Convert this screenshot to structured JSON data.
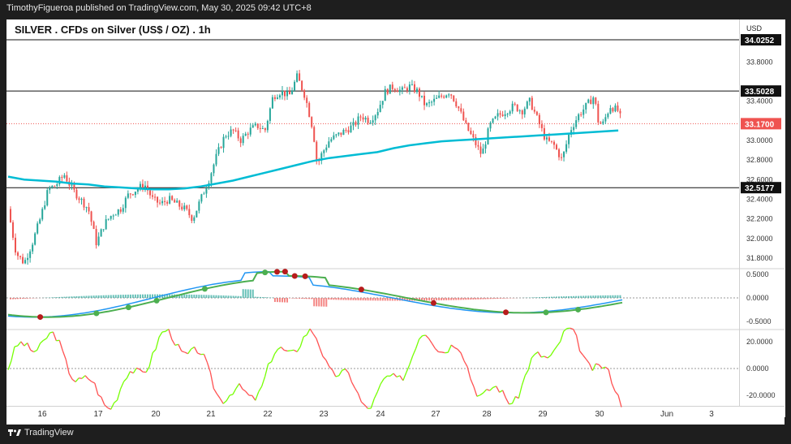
{
  "header": {
    "publish_text": "TimothyFigueroa published on TradingView.com, May 30, 2025 09:42 UTC+8",
    "title": "SILVER . CFDs on Silver (US$ / OZ) . 1h",
    "currency": "USD"
  },
  "footer": {
    "brand": "TradingView"
  },
  "colors": {
    "bull": "#26a69a",
    "bear": "#ef5350",
    "ma": "#00bcd4",
    "fast": "#2196f3",
    "slow_up": "#4caf50",
    "slow_down": "#b71c1c",
    "osc_up": "#76ff03",
    "osc_down": "#ff5252"
  },
  "chart_data": [
    {
      "type": "candlestick",
      "ylim": [
        31.7,
        34.1
      ],
      "y_ticks": [
        "33.8000",
        "33.4000",
        "33.0000",
        "32.8000",
        "32.6000",
        "32.4000",
        "32.2000",
        "32.0000",
        "31.8000"
      ],
      "y_tick_values": [
        33.8,
        33.4,
        33.0,
        32.8,
        32.6,
        32.4,
        32.2,
        32.0,
        31.8
      ],
      "horizontal_levels": [
        {
          "value": 34.0252,
          "label": "34.0252"
        },
        {
          "value": 33.5028,
          "label": "33.5028"
        },
        {
          "value": 32.5177,
          "label": "32.5177"
        }
      ],
      "last_price": {
        "value": 33.17,
        "label": "33.1700"
      },
      "x_ticks": [
        "16",
        "17",
        "20",
        "21",
        "22",
        "23",
        "24",
        "27",
        "28",
        "29",
        "30",
        "Jun",
        "3"
      ],
      "ma_path": [
        [
          0,
          32.63
        ],
        [
          20,
          32.6
        ],
        [
          40,
          32.59
        ],
        [
          60,
          32.58
        ],
        [
          80,
          32.56
        ],
        [
          100,
          32.55
        ],
        [
          120,
          32.53
        ],
        [
          140,
          32.52
        ],
        [
          160,
          32.51
        ],
        [
          180,
          32.5
        ],
        [
          200,
          32.5
        ],
        [
          220,
          32.51
        ],
        [
          240,
          32.53
        ],
        [
          260,
          32.56
        ],
        [
          280,
          32.59
        ],
        [
          300,
          32.63
        ],
        [
          320,
          32.67
        ],
        [
          340,
          32.71
        ],
        [
          360,
          32.75
        ],
        [
          380,
          32.79
        ],
        [
          400,
          32.82
        ],
        [
          420,
          32.84
        ],
        [
          440,
          32.86
        ],
        [
          460,
          32.88
        ],
        [
          480,
          32.92
        ],
        [
          500,
          32.95
        ],
        [
          520,
          32.97
        ],
        [
          540,
          32.99
        ],
        [
          560,
          33.0
        ],
        [
          580,
          33.01
        ],
        [
          600,
          33.02
        ],
        [
          620,
          33.03
        ],
        [
          640,
          33.04
        ],
        [
          660,
          33.05
        ],
        [
          680,
          33.06
        ],
        [
          700,
          33.07
        ],
        [
          720,
          33.08
        ],
        [
          740,
          33.09
        ],
        [
          760,
          33.1
        ]
      ],
      "close_path": [
        [
          0,
          32.3
        ],
        [
          10,
          31.85
        ],
        [
          20,
          31.75
        ],
        [
          30,
          31.95
        ],
        [
          40,
          32.2
        ],
        [
          50,
          32.5
        ],
        [
          60,
          32.55
        ],
        [
          70,
          32.65
        ],
        [
          80,
          32.5
        ],
        [
          90,
          32.4
        ],
        [
          100,
          32.3
        ],
        [
          110,
          31.95
        ],
        [
          120,
          32.15
        ],
        [
          130,
          32.25
        ],
        [
          140,
          32.3
        ],
        [
          150,
          32.45
        ],
        [
          160,
          32.5
        ],
        [
          170,
          32.55
        ],
        [
          180,
          32.4
        ],
        [
          190,
          32.35
        ],
        [
          200,
          32.4
        ],
        [
          210,
          32.35
        ],
        [
          220,
          32.3
        ],
        [
          230,
          32.2
        ],
        [
          240,
          32.4
        ],
        [
          250,
          32.6
        ],
        [
          260,
          32.85
        ],
        [
          270,
          33.05
        ],
        [
          280,
          33.1
        ],
        [
          290,
          33.0
        ],
        [
          300,
          33.1
        ],
        [
          310,
          33.15
        ],
        [
          320,
          33.1
        ],
        [
          330,
          33.45
        ],
        [
          340,
          33.5
        ],
        [
          350,
          33.45
        ],
        [
          360,
          33.65
        ],
        [
          370,
          33.45
        ],
        [
          380,
          33.1
        ],
        [
          385,
          32.75
        ],
        [
          390,
          32.85
        ],
        [
          400,
          33.0
        ],
        [
          410,
          33.05
        ],
        [
          420,
          33.1
        ],
        [
          430,
          33.15
        ],
        [
          440,
          33.25
        ],
        [
          450,
          33.2
        ],
        [
          460,
          33.3
        ],
        [
          470,
          33.5
        ],
        [
          480,
          33.55
        ],
        [
          490,
          33.5
        ],
        [
          500,
          33.55
        ],
        [
          510,
          33.5
        ],
        [
          520,
          33.35
        ],
        [
          530,
          33.4
        ],
        [
          540,
          33.45
        ],
        [
          550,
          33.5
        ],
        [
          560,
          33.35
        ],
        [
          570,
          33.15
        ],
        [
          580,
          33.0
        ],
        [
          590,
          32.85
        ],
        [
          600,
          33.15
        ],
        [
          610,
          33.25
        ],
        [
          620,
          33.3
        ],
        [
          630,
          33.35
        ],
        [
          640,
          33.3
        ],
        [
          650,
          33.4
        ],
        [
          660,
          33.2
        ],
        [
          670,
          33.0
        ],
        [
          680,
          32.95
        ],
        [
          690,
          32.8
        ],
        [
          700,
          33.1
        ],
        [
          710,
          33.25
        ],
        [
          720,
          33.35
        ],
        [
          730,
          33.45
        ],
        [
          735,
          33.2
        ],
        [
          740,
          33.15
        ],
        [
          750,
          33.35
        ],
        [
          760,
          33.3
        ],
        [
          765,
          33.17
        ]
      ]
    },
    {
      "type": "macd",
      "ylim": [
        -0.65,
        0.6
      ],
      "y_ticks": [
        "0.5000",
        "0.0000",
        "-0.5000"
      ],
      "y_tick_values": [
        0.5,
        0.0,
        -0.5
      ]
    },
    {
      "type": "oscillator",
      "ylim": [
        -28,
        28
      ],
      "y_ticks": [
        "20.0000",
        "0.0000",
        "-20.0000"
      ],
      "y_tick_values": [
        20,
        0,
        -20
      ]
    }
  ]
}
